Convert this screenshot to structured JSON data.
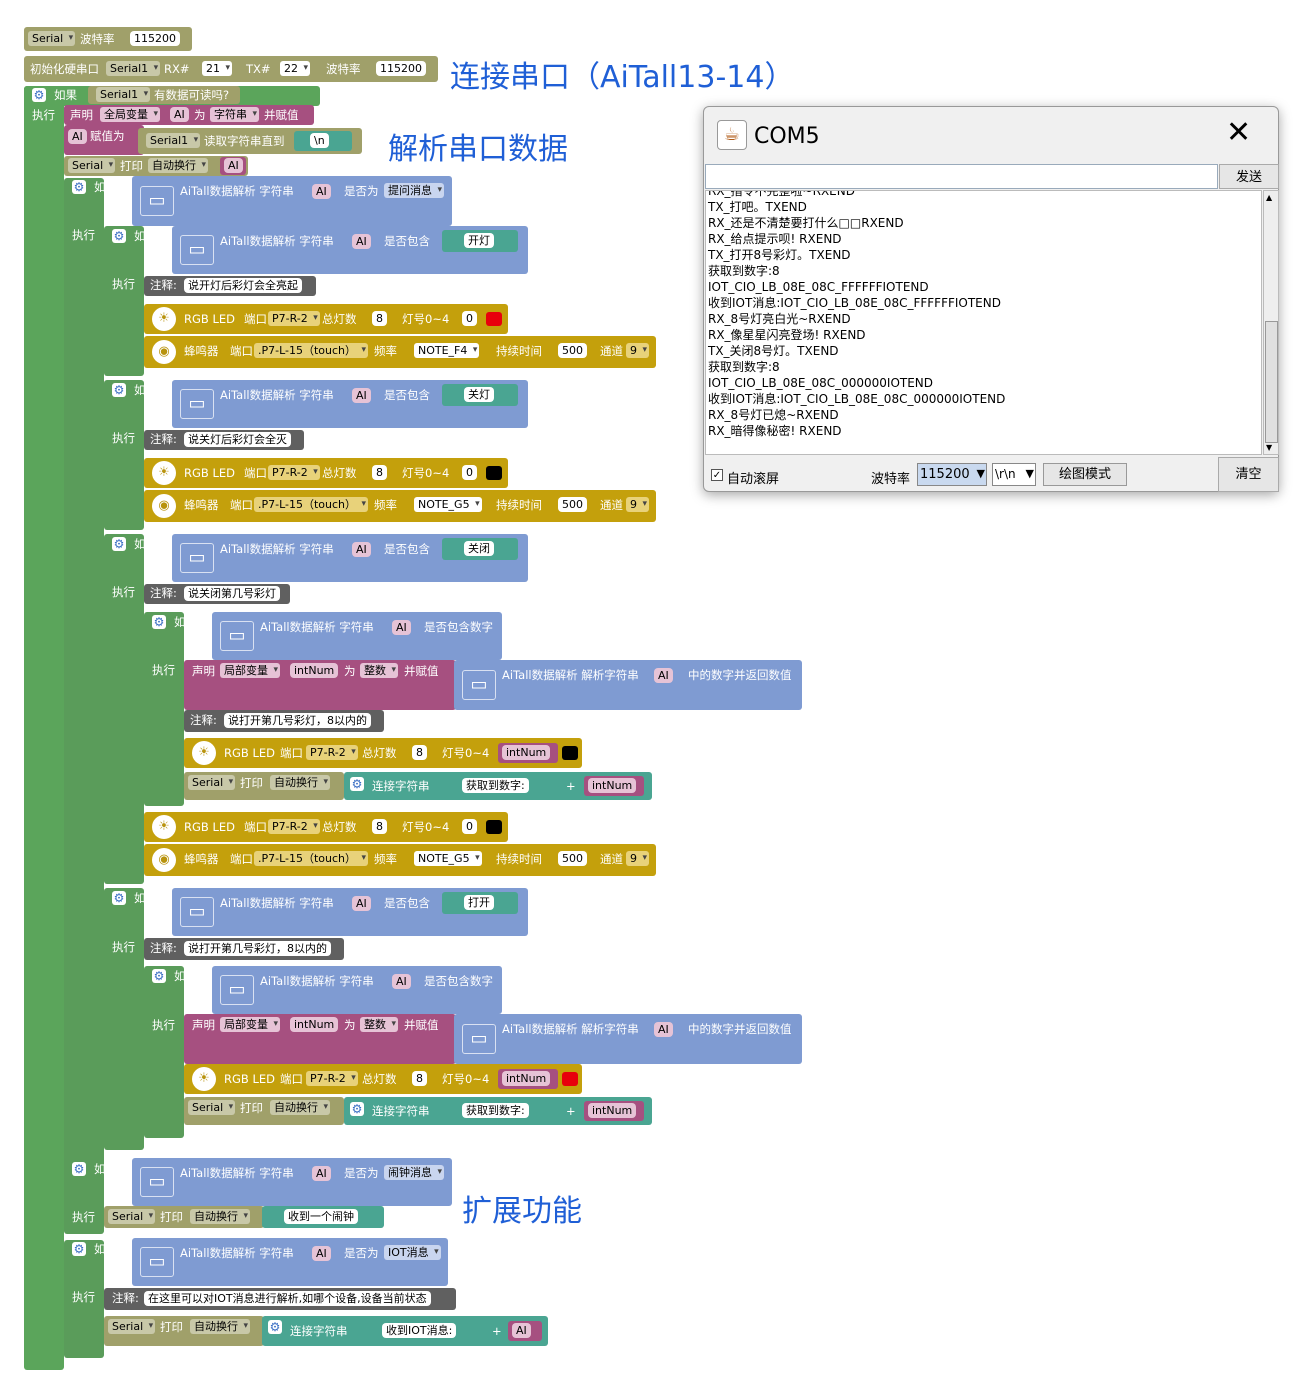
{
  "annotations": {
    "connect": "连接串口（AiTall13-14）",
    "parse": "解析串口数据",
    "extend": "扩展功能"
  },
  "blocks": {
    "serial_label": "Serial",
    "baud_label": "波特率",
    "baud_value": "115200",
    "init_hw": "初始化硬串口",
    "serial1": "Serial1",
    "rx": "RX#",
    "rx_pin": "21",
    "tx": "TX#",
    "tx_pin": "22",
    "if": "如果",
    "do": "执行",
    "has_data": "有数据可读吗?",
    "declare": "声明",
    "global_var": "全局变量",
    "var_ai": "AI",
    "as": "为",
    "string_type": "字符串",
    "and_assign": "并赋值",
    "assign": "赋值为",
    "read_until": "读取字符串直到",
    "newline_char": "\\n",
    "print": "打印",
    "auto_newline": "自动换行",
    "parse_str": "AiTall数据解析 字符串",
    "is_eq": "是否为",
    "contains": "是否包含",
    "contains_num": "是否包含数字",
    "parse_num": "AiTall数据解析 解析字符串",
    "num_return": "中的数字并返回数值",
    "prompt_msg": "提问消息",
    "alarm_msg": "闹钟消息",
    "iot_msg": "IOT消息",
    "kw_on": "开灯",
    "kw_off": "关灯",
    "kw_close": "关闭",
    "kw_open": "打开",
    "note": "注释:",
    "note1": "说开灯后彩灯会全亮起",
    "note2": "说关灯后彩灯会全灭",
    "note3": "说关闭第几号彩灯",
    "note4": "说打开第几号彩灯，8以内的",
    "note5": "说打开第几号彩灯，8以内的",
    "note6": "在这里可以对IOT消息进行解析,如哪个设备,设备当前状态",
    "rgb": "RGB LED",
    "port": "端口",
    "port_rgb": "P7-R-2",
    "total": "总灯数",
    "total_val": "8",
    "lamp": "灯号0~4",
    "lamp_zero": "0",
    "buzzer": "蜂鸣器",
    "port_buz": ".P7-L-15（touch）",
    "freq": "频率",
    "note_f4": "NOTE_F4",
    "note_g5": "NOTE_G5",
    "duration": "持续时间",
    "dur_val": "500",
    "channel": "通道",
    "ch_val": "9",
    "local_var": "局部变量",
    "intnum": "intNum",
    "int_type": "整数",
    "concat": "连接字符串",
    "got_num": "获取到数字:",
    "plus": "+",
    "got_alarm": "收到一个闹钟",
    "got_iot": "收到IOT消息:"
  },
  "colors": {
    "red": "#e8000c",
    "black": "#000000"
  },
  "com": {
    "title": "COM5",
    "send": "发送",
    "lines": [
      "RX_指令不完整啦~RXEND",
      "TX_打吧。TXEND",
      "RX_还是不清楚要打什么□□RXEND",
      "RX_给点提示呗! RXEND",
      "TX_打开8号彩灯。TXEND",
      "获取到数字:8",
      "IOT_CIO_LB_08E_08C_FFFFFFIOTEND",
      "收到IOT消息:IOT_CIO_LB_08E_08C_FFFFFFIOTEND",
      "RX_8号灯亮白光~RXEND",
      "RX_像星星闪亮登场! RXEND",
      "TX_关闭8号灯。TXEND",
      "获取到数字:8",
      "IOT_CIO_LB_08E_08C_000000IOTEND",
      "收到IOT消息:IOT_CIO_LB_08E_08C_000000IOTEND",
      "RX_8号灯已熄~RXEND",
      "RX_暗得像秘密! RXEND"
    ],
    "autoscroll": "自动滚屏",
    "baud_label": "波特率",
    "baud": "115200",
    "ending": "\\r\\n",
    "plot": "绘图模式",
    "clear": "清空"
  }
}
